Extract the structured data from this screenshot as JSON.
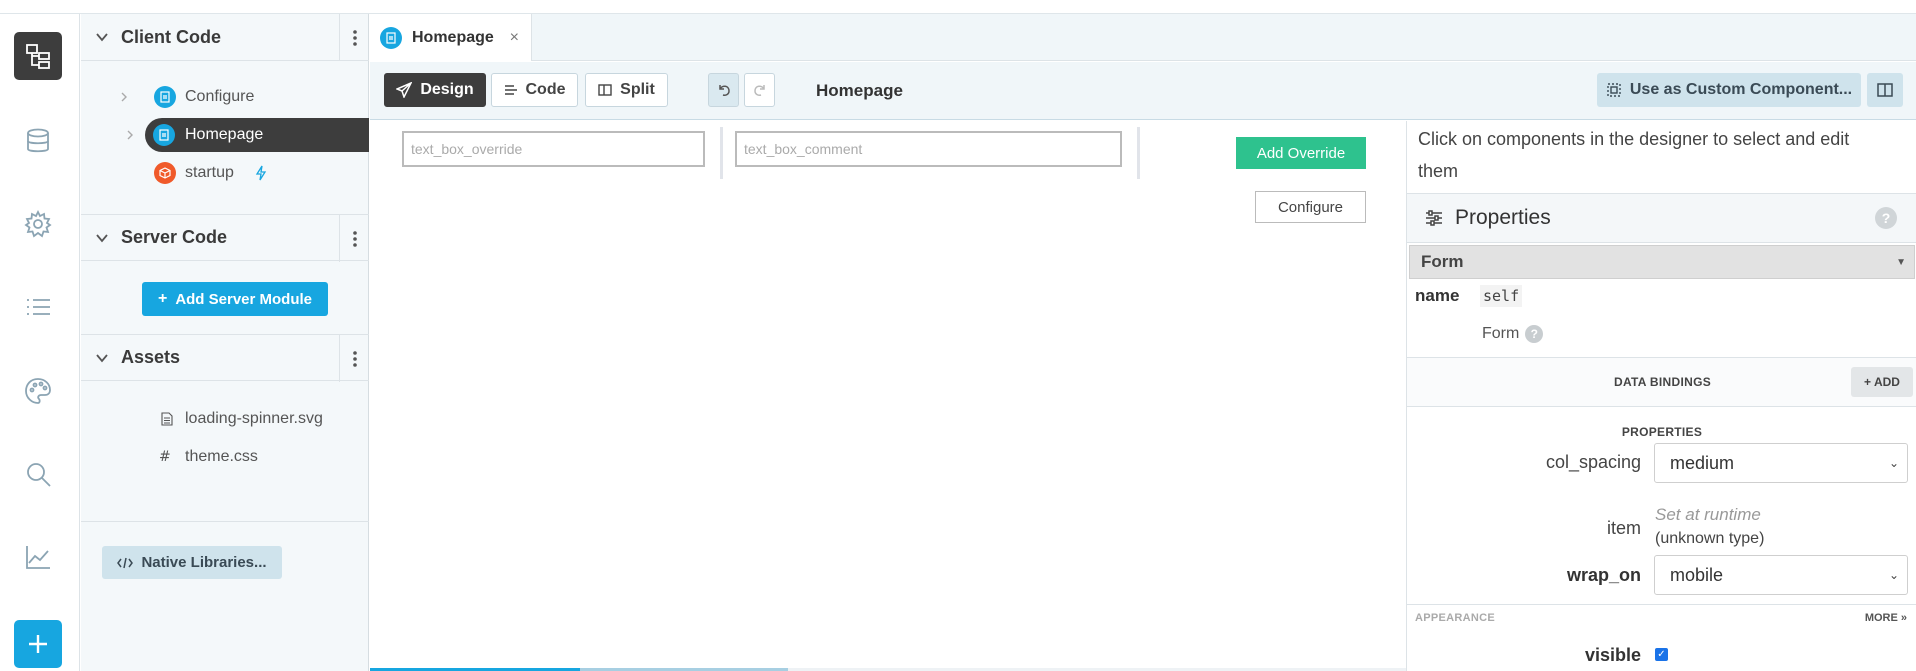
{
  "tree": {
    "client_code": {
      "title": "Client Code",
      "items": [
        {
          "label": "Configure"
        },
        {
          "label": "Homepage"
        },
        {
          "label": "startup"
        }
      ]
    },
    "server_code": {
      "title": "Server Code",
      "add_label": "Add Server Module"
    },
    "assets": {
      "title": "Assets",
      "items": [
        {
          "label": "loading-spinner.svg",
          "icon": "file-icon"
        },
        {
          "label": "theme.css",
          "icon": "#"
        }
      ]
    },
    "native_libraries_label": "Native Libraries..."
  },
  "tab": {
    "label": "Homepage",
    "close": "×"
  },
  "toolbar": {
    "design_label": "Design",
    "code_label": "Code",
    "split_label": "Split",
    "form_title": "Homepage",
    "custom_component_label": "Use as Custom Component..."
  },
  "canvas": {
    "text_box_override_placeholder": "text_box_override",
    "text_box_comment_placeholder": "text_box_comment",
    "add_override_label": "Add Override",
    "configure_label": "Configure"
  },
  "props": {
    "hint": "Click on components in the designer to select and edit them",
    "title": "Properties",
    "help": "?",
    "component": "Form",
    "name_label": "name",
    "name_value": "self",
    "type_label": "Form",
    "data_bindings_label": "DATA BINDINGS",
    "add_label": "+ ADD",
    "properties_label": "PROPERTIES",
    "col_spacing_label": "col_spacing",
    "col_spacing_value": "medium",
    "item_label": "item",
    "item_runtime": "Set at runtime",
    "item_type": "(unknown type)",
    "wrap_on_label": "wrap_on",
    "wrap_on_value": "mobile",
    "appearance_label": "APPEARANCE",
    "more_label": "MORE",
    "visible_label": "visible"
  },
  "colors": {
    "accent": "#17a6e0",
    "dark": "#3d3d3d",
    "green": "#2ec28e",
    "startup_icon": "#f05a2a"
  }
}
